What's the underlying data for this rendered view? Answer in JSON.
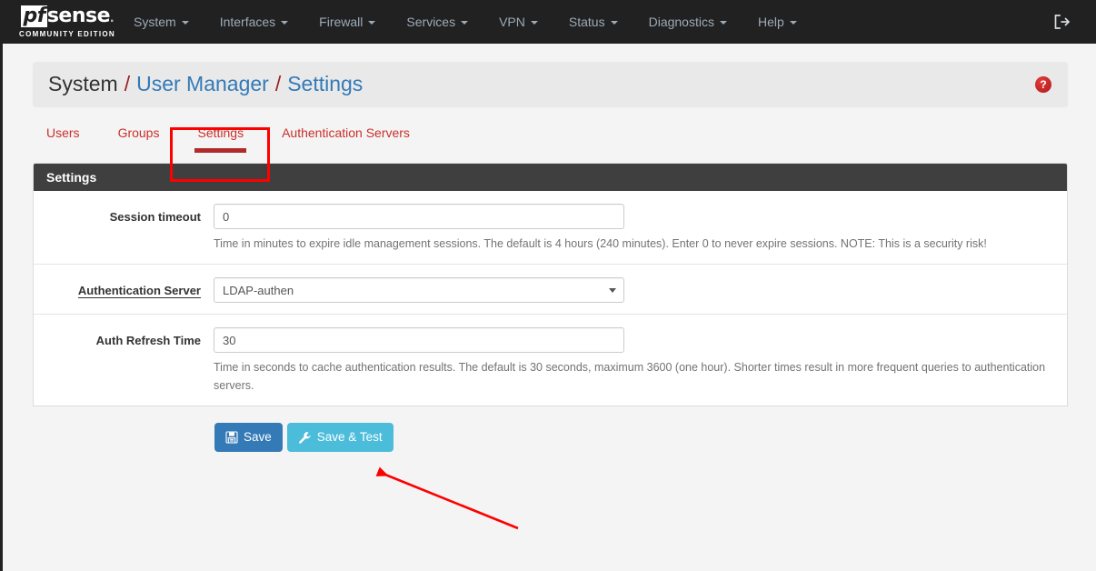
{
  "navbar": {
    "brand": {
      "pf": "pf",
      "sense": "sense",
      "subtitle": "COMMUNITY EDITION"
    },
    "items": [
      {
        "label": "System",
        "has_caret": true
      },
      {
        "label": "Interfaces",
        "has_caret": true
      },
      {
        "label": "Firewall",
        "has_caret": true
      },
      {
        "label": "Services",
        "has_caret": true
      },
      {
        "label": "VPN",
        "has_caret": true
      },
      {
        "label": "Status",
        "has_caret": true
      },
      {
        "label": "Diagnostics",
        "has_caret": true
      },
      {
        "label": "Help",
        "has_caret": true
      }
    ],
    "logout_icon": "logout-icon"
  },
  "breadcrumb": {
    "part1": "System",
    "sep1": "/",
    "part2": "User Manager",
    "sep2": "/",
    "part3": "Settings",
    "help_icon_label": "?"
  },
  "tabs": [
    {
      "label": "Users",
      "active": false
    },
    {
      "label": "Groups",
      "active": false
    },
    {
      "label": "Settings",
      "active": true
    },
    {
      "label": "Authentication Servers",
      "active": false
    }
  ],
  "panel": {
    "heading": "Settings",
    "fields": {
      "session_timeout": {
        "label": "Session timeout",
        "value": "0",
        "placeholder": "",
        "help": "Time in minutes to expire idle management sessions. The default is 4 hours (240 minutes). Enter 0 to never expire sessions. NOTE: This is a security risk!"
      },
      "auth_server": {
        "label": "Authentication Server",
        "value": "LDAP-authen",
        "options": [
          "LDAP-authen"
        ]
      },
      "auth_refresh_time": {
        "label": "Auth Refresh Time",
        "value": "30",
        "placeholder": "",
        "help": "Time in seconds to cache authentication results. The default is 30 seconds, maximum 3600 (one hour). Shorter times result in more frequent queries to authentication servers."
      }
    }
  },
  "buttons": {
    "save": {
      "label": "Save",
      "icon": "floppy-disk-icon",
      "color": "#337ab7"
    },
    "save_and_test": {
      "label": "Save & Test",
      "icon": "wrench-icon",
      "color": "#4cbcdb"
    }
  },
  "annotations": {
    "tab_highlight_color": "#fe0000",
    "arrow_color": "#fe0000",
    "target": "Save & Test"
  }
}
